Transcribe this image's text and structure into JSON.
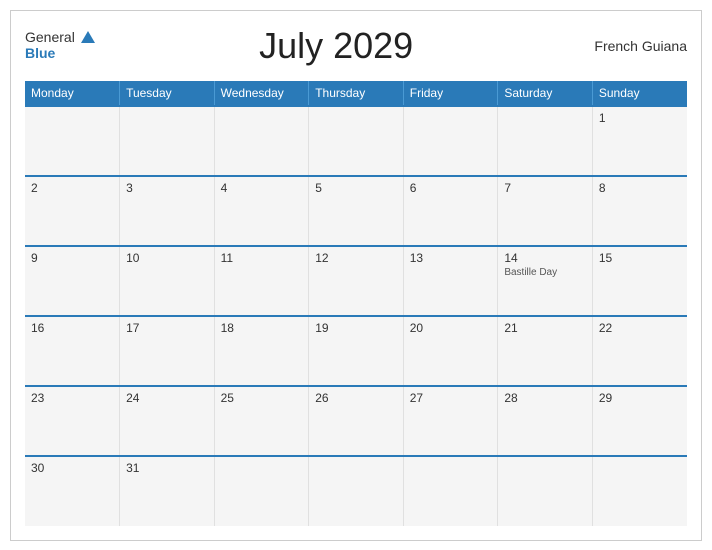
{
  "header": {
    "logo_general": "General",
    "logo_blue": "Blue",
    "title": "July 2029",
    "region": "French Guiana"
  },
  "days_of_week": [
    "Monday",
    "Tuesday",
    "Wednesday",
    "Thursday",
    "Friday",
    "Saturday",
    "Sunday"
  ],
  "weeks": [
    [
      {
        "day": "",
        "empty": true
      },
      {
        "day": "",
        "empty": true
      },
      {
        "day": "",
        "empty": true
      },
      {
        "day": "",
        "empty": true
      },
      {
        "day": "",
        "empty": true
      },
      {
        "day": "",
        "empty": true
      },
      {
        "day": "1",
        "empty": false,
        "holiday": ""
      }
    ],
    [
      {
        "day": "2",
        "empty": false,
        "holiday": ""
      },
      {
        "day": "3",
        "empty": false,
        "holiday": ""
      },
      {
        "day": "4",
        "empty": false,
        "holiday": ""
      },
      {
        "day": "5",
        "empty": false,
        "holiday": ""
      },
      {
        "day": "6",
        "empty": false,
        "holiday": ""
      },
      {
        "day": "7",
        "empty": false,
        "holiday": ""
      },
      {
        "day": "8",
        "empty": false,
        "holiday": ""
      }
    ],
    [
      {
        "day": "9",
        "empty": false,
        "holiday": ""
      },
      {
        "day": "10",
        "empty": false,
        "holiday": ""
      },
      {
        "day": "11",
        "empty": false,
        "holiday": ""
      },
      {
        "day": "12",
        "empty": false,
        "holiday": ""
      },
      {
        "day": "13",
        "empty": false,
        "holiday": ""
      },
      {
        "day": "14",
        "empty": false,
        "holiday": "Bastille Day"
      },
      {
        "day": "15",
        "empty": false,
        "holiday": ""
      }
    ],
    [
      {
        "day": "16",
        "empty": false,
        "holiday": ""
      },
      {
        "day": "17",
        "empty": false,
        "holiday": ""
      },
      {
        "day": "18",
        "empty": false,
        "holiday": ""
      },
      {
        "day": "19",
        "empty": false,
        "holiday": ""
      },
      {
        "day": "20",
        "empty": false,
        "holiday": ""
      },
      {
        "day": "21",
        "empty": false,
        "holiday": ""
      },
      {
        "day": "22",
        "empty": false,
        "holiday": ""
      }
    ],
    [
      {
        "day": "23",
        "empty": false,
        "holiday": ""
      },
      {
        "day": "24",
        "empty": false,
        "holiday": ""
      },
      {
        "day": "25",
        "empty": false,
        "holiday": ""
      },
      {
        "day": "26",
        "empty": false,
        "holiday": ""
      },
      {
        "day": "27",
        "empty": false,
        "holiday": ""
      },
      {
        "day": "28",
        "empty": false,
        "holiday": ""
      },
      {
        "day": "29",
        "empty": false,
        "holiday": ""
      }
    ],
    [
      {
        "day": "30",
        "empty": false,
        "holiday": ""
      },
      {
        "day": "31",
        "empty": false,
        "holiday": ""
      },
      {
        "day": "",
        "empty": true
      },
      {
        "day": "",
        "empty": true
      },
      {
        "day": "",
        "empty": true
      },
      {
        "day": "",
        "empty": true
      },
      {
        "day": "",
        "empty": true
      }
    ]
  ],
  "colors": {
    "header_bg": "#2a7ab8",
    "blue_accent": "#2a7ab8",
    "cell_bg": "#f5f5f5"
  }
}
